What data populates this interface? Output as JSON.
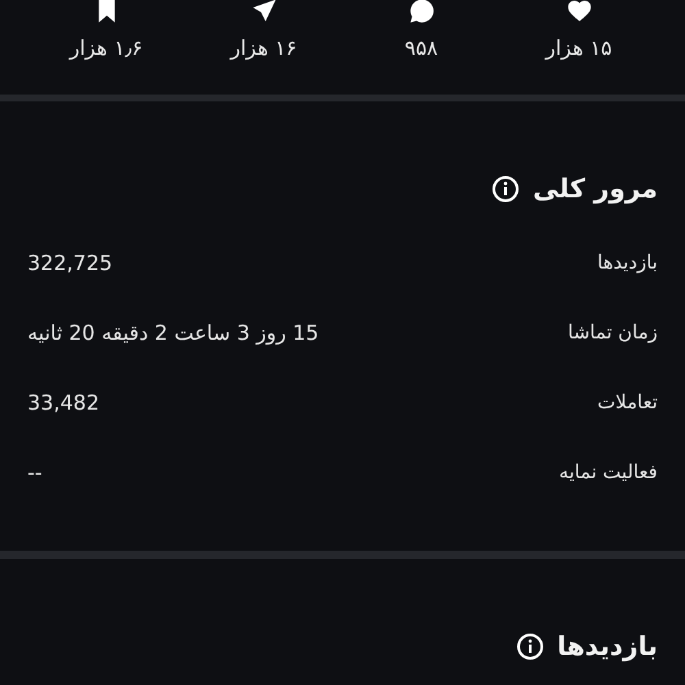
{
  "stats": [
    {
      "kind": "heart",
      "value": "۱۵ هزار"
    },
    {
      "kind": "comment",
      "value": "۹۵۸"
    },
    {
      "kind": "send",
      "value": "۱۶ هزار"
    },
    {
      "kind": "bookmark",
      "value": "۱٫۶ هزار"
    }
  ],
  "overview": {
    "title": "مرور کلی",
    "rows": [
      {
        "label": "بازدیدها",
        "value": "322,725"
      },
      {
        "label": "زمان تماشا",
        "value": "15 روز 3 ساعت 2 دقیقه 20 ثانیه"
      },
      {
        "label": "تعاملات",
        "value": "33,482"
      },
      {
        "label": "فعالیت نمایه",
        "value": "--"
      }
    ]
  },
  "views": {
    "title": "بازدیدها"
  }
}
